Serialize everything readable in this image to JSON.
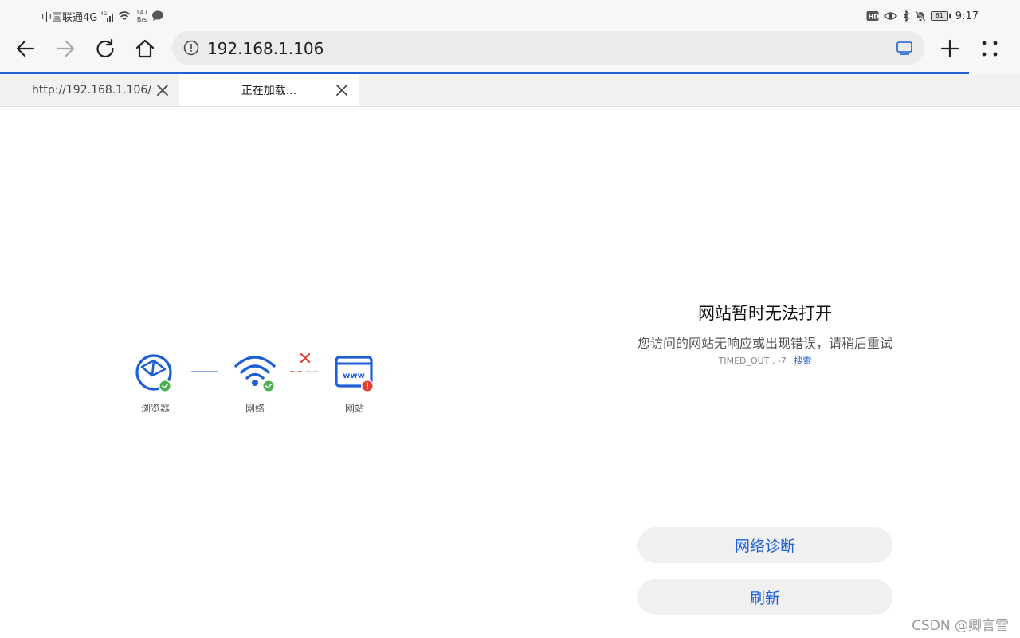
{
  "status_bar": {
    "carrier": "中国联通4G",
    "network_speed_value": "147",
    "network_speed_unit": "B/s",
    "battery_level": "61",
    "time": "9:17"
  },
  "toolbar": {
    "url": "192.168.1.106"
  },
  "page_load_progress": 0.95,
  "tabs": [
    {
      "title": "http://192.168.1.106/",
      "active": false
    },
    {
      "title": "正在加载...",
      "active": true
    }
  ],
  "diagram": {
    "browser_label": "浏览器",
    "network_label": "网络",
    "website_label": "网站"
  },
  "error": {
    "title": "网站暂时无法打开",
    "description": "您访问的网站无响应或出现错误，请稍后重试",
    "code": "TIMED_OUT , -7",
    "search_link": "搜索"
  },
  "buttons": {
    "diagnose": "网络诊断",
    "refresh": "刷新"
  },
  "watermark": "CSDN @卿言雪",
  "colors": {
    "accent": "#1f5fd6",
    "ok": "#4caf50",
    "error": "#e04035"
  }
}
